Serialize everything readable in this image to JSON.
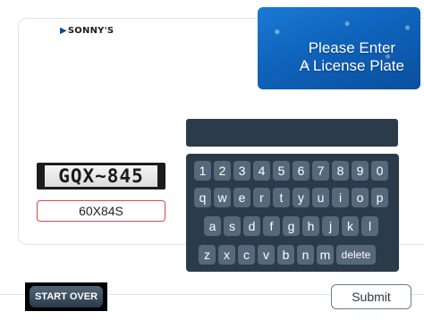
{
  "brand": {
    "logo_text": "SONNY'S",
    "logo_mark": "▶"
  },
  "banner": {
    "line1": "Please Enter",
    "line2": "A License Plate"
  },
  "plate": {
    "captured_text": "GQX~845",
    "input_value": "60X84S"
  },
  "keyboard": {
    "row1": [
      "1",
      "2",
      "3",
      "4",
      "5",
      "6",
      "7",
      "8",
      "9",
      "0"
    ],
    "row2": [
      "q",
      "w",
      "e",
      "r",
      "t",
      "y",
      "u",
      "i",
      "o",
      "p"
    ],
    "row3": [
      "a",
      "s",
      "d",
      "f",
      "g",
      "h",
      "j",
      "k",
      "l"
    ],
    "row4": [
      "z",
      "x",
      "c",
      "v",
      "b",
      "n",
      "m"
    ],
    "delete_label": "delete"
  },
  "actions": {
    "start_over": "START OVER",
    "submit": "Submit"
  },
  "colors": {
    "key_bg": "#56697b",
    "keyboard_bg": "#2c3b49",
    "banner_blue": "#0f63bb",
    "input_border": "#d64a4a"
  }
}
